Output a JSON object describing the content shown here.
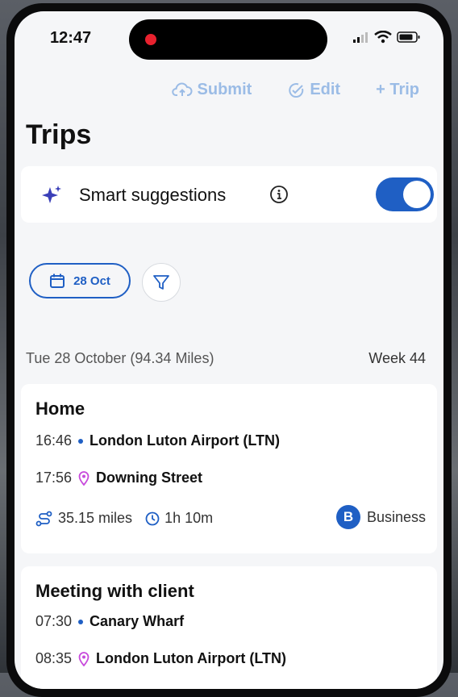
{
  "status_bar": {
    "time": "12:47"
  },
  "toolbar": {
    "submit_label": "Submit",
    "edit_label": "Edit",
    "trip_label": "+ Trip"
  },
  "page": {
    "title": "Trips"
  },
  "smart_suggestions": {
    "label": "Smart suggestions",
    "enabled": true
  },
  "filters": {
    "date_chip": "28 Oct"
  },
  "day": {
    "heading": "Tue 28 October (94.34 Miles)",
    "week": "Week 44"
  },
  "trips": [
    {
      "title": "Home",
      "start_time": "16:46",
      "start_place": "London Luton Airport (LTN)",
      "end_time": "17:56",
      "end_place": "Downing Street",
      "distance": "35.15 miles",
      "duration": "1h 10m",
      "category_badge": "B",
      "category": "Business"
    },
    {
      "title": "Meeting with client",
      "start_time": "07:30",
      "start_place": "Canary Wharf",
      "end_time": "08:35",
      "end_place": "London Luton Airport (LTN)"
    }
  ],
  "colors": {
    "accent": "#1f5fc4",
    "accent_light": "#9bbce6",
    "start_dot": "#1f5fc4",
    "end_pin": "#c84bdc",
    "recording_dot": "#e8212e"
  },
  "icons": [
    "upload-cloud-icon",
    "check-circle-icon",
    "sparkle-icon",
    "info-icon",
    "calendar-icon",
    "filter-icon",
    "location-pin-icon",
    "route-icon",
    "clock-icon",
    "signal-icon",
    "wifi-icon",
    "battery-icon"
  ]
}
